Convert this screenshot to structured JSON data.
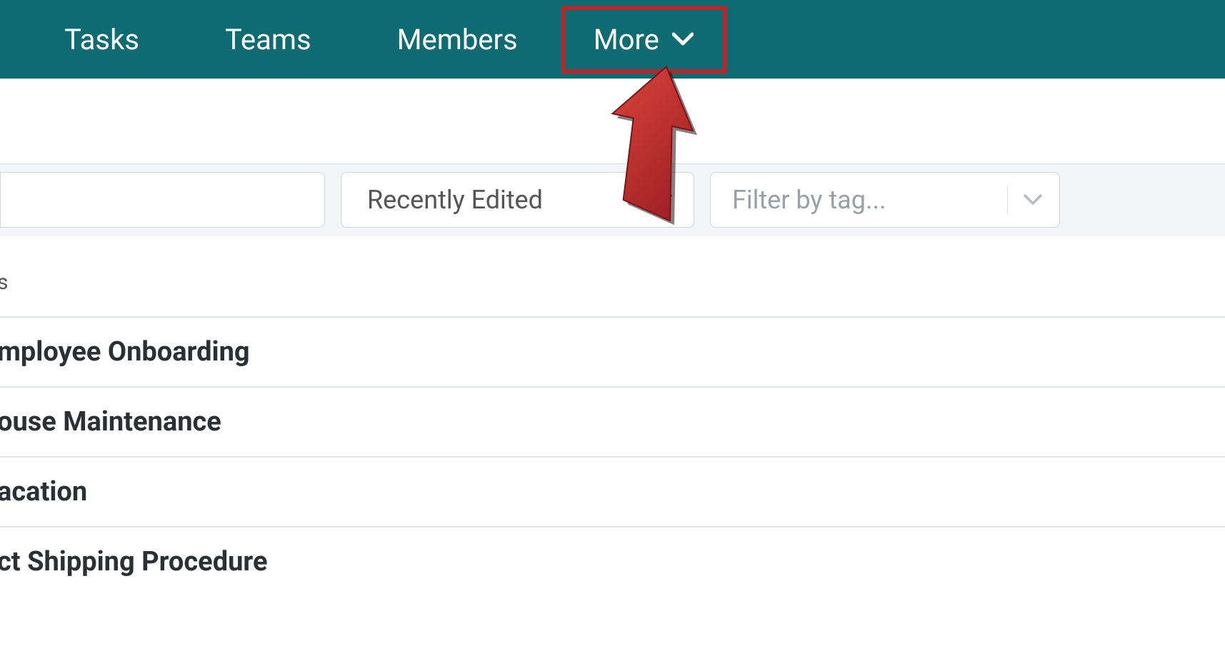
{
  "nav": {
    "items": [
      {
        "label": "Tasks"
      },
      {
        "label": "Teams"
      },
      {
        "label": "Members"
      },
      {
        "label": "More"
      }
    ]
  },
  "filters": {
    "search_value": "",
    "sort_select": {
      "selected": "Recently Edited"
    },
    "tag_filter": {
      "placeholder": "Filter by tag..."
    }
  },
  "list": {
    "section_header_text": "s",
    "items": [
      {
        "title": "mployee Onboarding"
      },
      {
        "title": "ouse Maintenance"
      },
      {
        "title": "acation"
      },
      {
        "title": "ct Shipping Procedure"
      }
    ]
  },
  "colors": {
    "teal": "#0e6b72",
    "accent_red": "#b4272d"
  }
}
